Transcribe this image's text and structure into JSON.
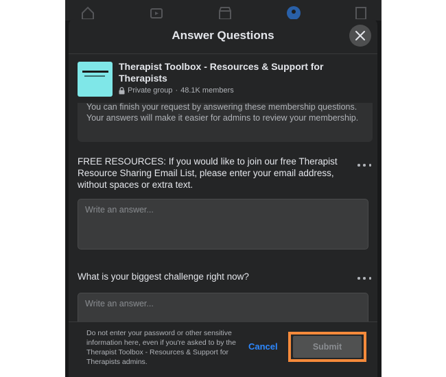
{
  "modal": {
    "title": "Answer Questions"
  },
  "group": {
    "thumbnail_text": "THERAPIST",
    "name": "Therapist Toolbox - Resources & Support for Therapists",
    "privacy": "Private group",
    "members": "48.1K members",
    "separator": "·"
  },
  "info": {
    "text": "You can finish your request by answering these membership questions. Your answers will make it easier for admins to review your membership."
  },
  "questions": [
    {
      "text": "FREE RESOURCES: If you would like to join our free Therapist Resource Sharing Email List, please enter your email address, without spaces or extra text.",
      "placeholder": "Write an answer..."
    },
    {
      "text": "What is your biggest challenge right now?",
      "placeholder": "Write an answer..."
    }
  ],
  "footer": {
    "disclaimer": "Do not enter your password or other sensitive information here, even if you're asked to by the Therapist Toolbox - Resources & Support for Therapists admins.",
    "cancel_label": "Cancel",
    "submit_label": "Submit"
  },
  "colors": {
    "background": "#18191a",
    "surface": "#242526",
    "accent_blue": "#2d88ff",
    "highlight_orange": "#f58a3b",
    "text_primary": "#e4e6eb",
    "text_secondary": "#b0b3b8"
  },
  "icons": [
    "home-icon",
    "watch-icon",
    "marketplace-icon",
    "groups-icon",
    "pages-icon",
    "close-icon",
    "lock-icon",
    "more-icon"
  ]
}
